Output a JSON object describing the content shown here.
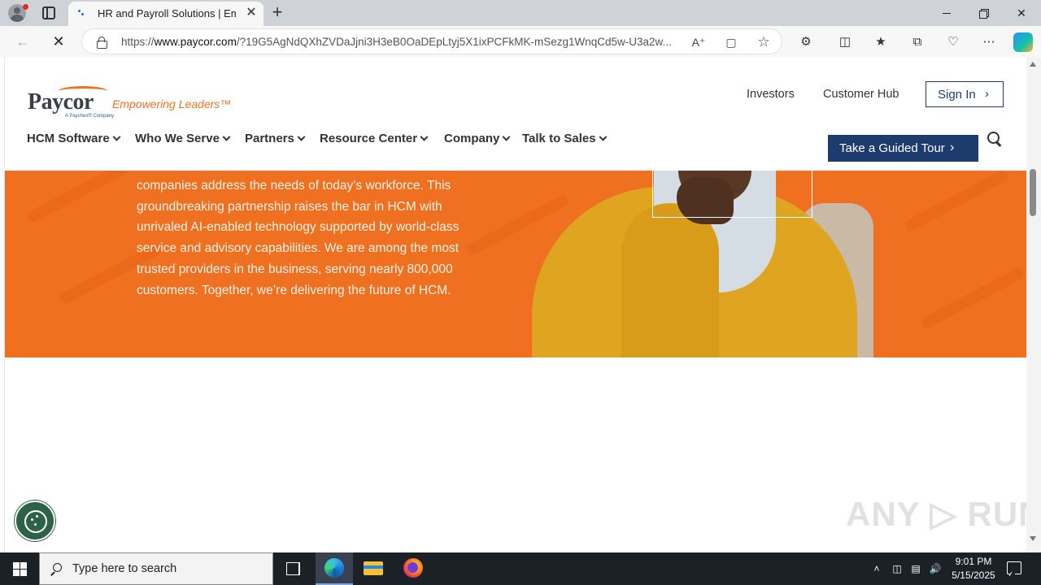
{
  "browser": {
    "tab_title": "HR and Payroll Solutions | Empowering Leaders",
    "tab_close": "✕",
    "new_tab": "+",
    "url_prefix": "https://",
    "url_host": "www.paycor.com",
    "url_rest": "/?19G5AgNdQXhZVDaJjni3H3eB0OaDEpLtyj5X1ixPCFkMK-mSezg1WnqCd5w-U3a2w...",
    "window_controls": {
      "minimize": "",
      "restore": "",
      "close": "✕"
    },
    "icons": [
      "read-aloud-icon",
      "immersive-reader-icon",
      "favorite-star-icon",
      "extensions-icon",
      "split-screen-icon",
      "favorites-icon",
      "collections-icon",
      "browser-essentials-icon",
      "more-icon",
      "copilot-icon"
    ]
  },
  "site": {
    "logo_word": "Paycor",
    "logo_tagline": "Empowering Leaders™",
    "logo_sub": "A Paychex® Company",
    "utility_links": {
      "investors": "Investors",
      "customer_hub": "Customer Hub",
      "sign_in": "Sign In"
    },
    "nav": [
      "HCM Software",
      "Who We Serve",
      "Partners",
      "Resource Center",
      "Company",
      "Talk to Sales"
    ],
    "tour_button": "Take a Guided Tour",
    "hero_text": "companies address the needs of today’s workforce. This groundbreaking partnership raises the bar in HCM with unrivaled AI-enabled technology supported by world-class service and advisory capabilities. We are among the most trusted providers in the business, serving nearly 800,000 customers. Together, we’re delivering the future of HCM.",
    "watermark": "ANY ▷ RUN"
  },
  "taskbar": {
    "search_placeholder": "Type here to search",
    "time": "9:01 PM",
    "date": "5/15/2025"
  },
  "colors": {
    "accent_orange": "#ef7021",
    "navy": "#1e3b6e",
    "cookie_green": "#2e6248"
  }
}
